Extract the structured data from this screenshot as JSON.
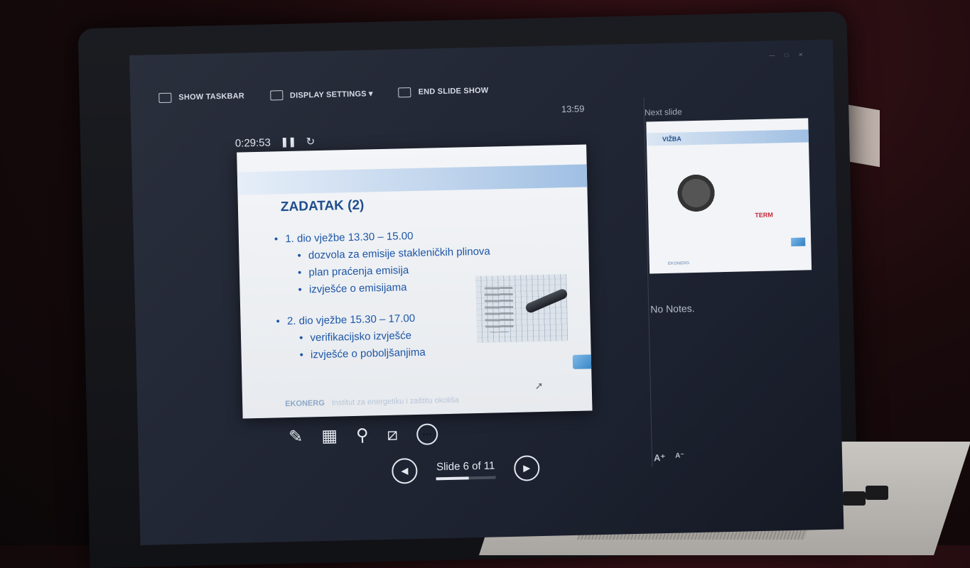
{
  "toolbar": {
    "show_taskbar": "SHOW TASKBAR",
    "display_settings": "DISPLAY SETTINGS ▾",
    "end_slide_show": "END SLIDE SHOW"
  },
  "clock": "13:59",
  "timer": {
    "elapsed": "0:29:53",
    "pause_glyph": "❚❚",
    "restart_glyph": "↻"
  },
  "slide": {
    "title": "ZADATAK (2)",
    "part1": "1. dio vježbe 13.30 – 15.00",
    "part1_items": [
      "dozvola za emisije stakleničkih plinova",
      "plan praćenja emisija",
      "izvješće o emisijama"
    ],
    "part2": "2. dio vježbe 15.30 – 17.00",
    "part2_items": [
      "verifikacijsko izvješće",
      "izvješće o poboljšanjima"
    ],
    "footer": "EKONERG",
    "footer_sub": "Institut za energetiku i zaštitu okoliša"
  },
  "controls": {
    "pen": "✎",
    "grid": "▦",
    "zoom": "⚲",
    "blackout": "⧄",
    "more": "···"
  },
  "navigation": {
    "prev": "◀",
    "next": "▶",
    "counter": "Slide 6 of 11",
    "progress": 0.55
  },
  "next_slide": {
    "label": "Next slide",
    "title": "VIŽBA",
    "term_text": "TERM",
    "footer": "EKONERG"
  },
  "notes": "No Notes.",
  "font_controls": {
    "increase": "A⁺",
    "decrease": "A⁻"
  },
  "colors": {
    "accent": "#1d56a6",
    "title": "#1f4e8c"
  }
}
